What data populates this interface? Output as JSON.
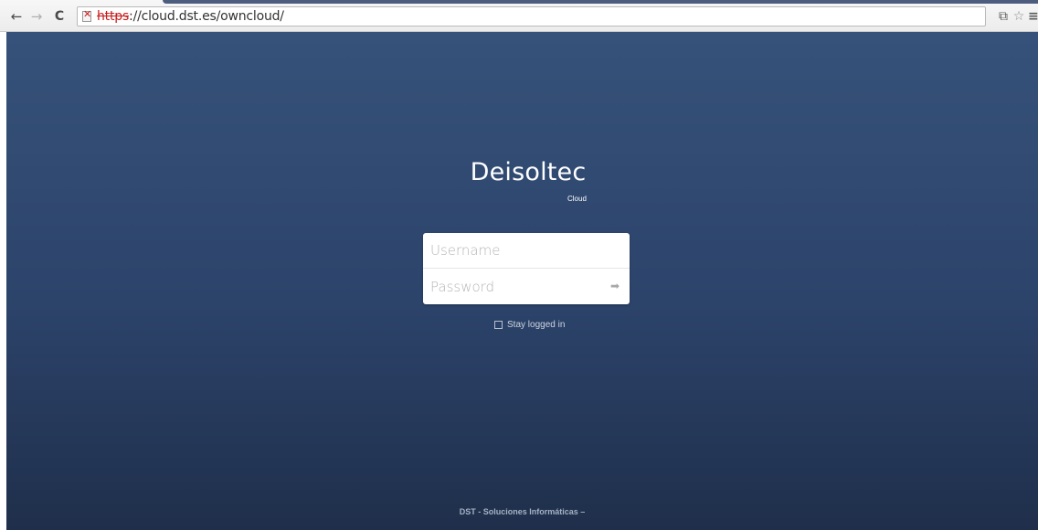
{
  "browser": {
    "url_scheme": "https",
    "url_rest": "://cloud.dst.es/owncloud/",
    "nav": {
      "back_glyph": "←",
      "forward_glyph": "→",
      "reload_glyph": "C"
    },
    "icons": {
      "translate_glyph": "⧉",
      "star_glyph": "☆",
      "menu_glyph": "≡"
    }
  },
  "page": {
    "brand_title": "Deisoltec",
    "brand_subtitle": "Cloud",
    "login": {
      "username_placeholder": "Username",
      "password_placeholder": "Password",
      "submit_glyph": "➡",
      "remember_label": "Stay logged in"
    },
    "footer_text": "DST - Soluciones Informáticas –"
  },
  "colors": {
    "background_top": "#36527a",
    "background_bottom": "#1f2f4b",
    "security_warning": "#c51c1c"
  }
}
